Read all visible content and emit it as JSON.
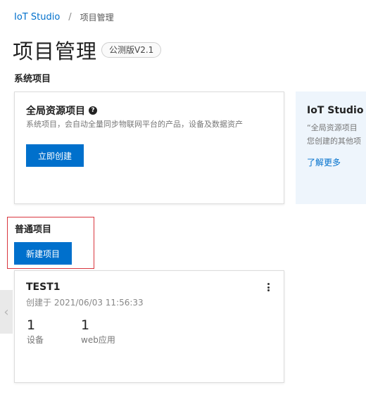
{
  "breadcrumb": {
    "root": "IoT Studio",
    "separator": "/",
    "current": "项目管理"
  },
  "header": {
    "title": "项目管理",
    "badge": "公测版V2.1"
  },
  "system_section": {
    "title": "系统项目",
    "card": {
      "title": "全局资源项目",
      "help_glyph": "?",
      "description": "系统项目，会自动全量同步物联网平台的产品，设备及数据资产",
      "button": "立即创建"
    }
  },
  "info_panel": {
    "title": "IoT Studio 全",
    "line1": "“全局资源项目",
    "line2": "您创建的其他项",
    "link": "了解更多"
  },
  "normal_section": {
    "title": "普通项目",
    "new_button": "新建项目"
  },
  "side_arrow": "‹",
  "project": {
    "name": "TEST1",
    "created": "创建于 2021/06/03 11:56:33",
    "stats": [
      {
        "value": "1",
        "label": "设备"
      },
      {
        "value": "1",
        "label": "web应用"
      }
    ]
  },
  "colors": {
    "primary": "#0070cc",
    "highlight": "#d9363e",
    "info_bg": "#eef5fc"
  }
}
